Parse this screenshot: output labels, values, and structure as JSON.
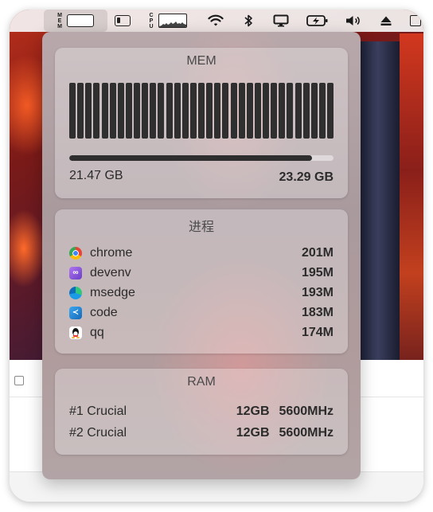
{
  "menubar": {
    "mem_label": "MEM",
    "cpu_label": "CPU",
    "icons": [
      "memory-monitor",
      "battery-icon",
      "cpu-graph",
      "wifi-icon",
      "bluetooth-icon",
      "display-icon",
      "battery-charging-icon",
      "volume-icon",
      "eject-icon",
      "app-icon"
    ]
  },
  "memory": {
    "title": "MEM",
    "used": "21.47 GB",
    "total": "23.29 GB",
    "usage_fraction": 0.92,
    "bar_count": 33
  },
  "processes": {
    "title": "进程",
    "items": [
      {
        "name": "chrome",
        "value": "201M",
        "icon": "chrome-icon",
        "color": "#e74c3c"
      },
      {
        "name": "devenv",
        "value": "195M",
        "icon": "visual-studio-icon",
        "color": "#8e5cd9"
      },
      {
        "name": "msedge",
        "value": "193M",
        "icon": "edge-icon",
        "color": "#1f9ad6"
      },
      {
        "name": "code",
        "value": "183M",
        "icon": "vscode-icon",
        "color": "#2b8fd6"
      },
      {
        "name": "qq",
        "value": "174M",
        "icon": "qq-icon",
        "color": "#222222"
      }
    ]
  },
  "ram": {
    "title": "RAM",
    "modules": [
      {
        "name": "#1 Crucial",
        "size": "12GB",
        "speed": "5600MHz"
      },
      {
        "name": "#2 Crucial",
        "size": "12GB",
        "speed": "5600MHz"
      }
    ]
  }
}
